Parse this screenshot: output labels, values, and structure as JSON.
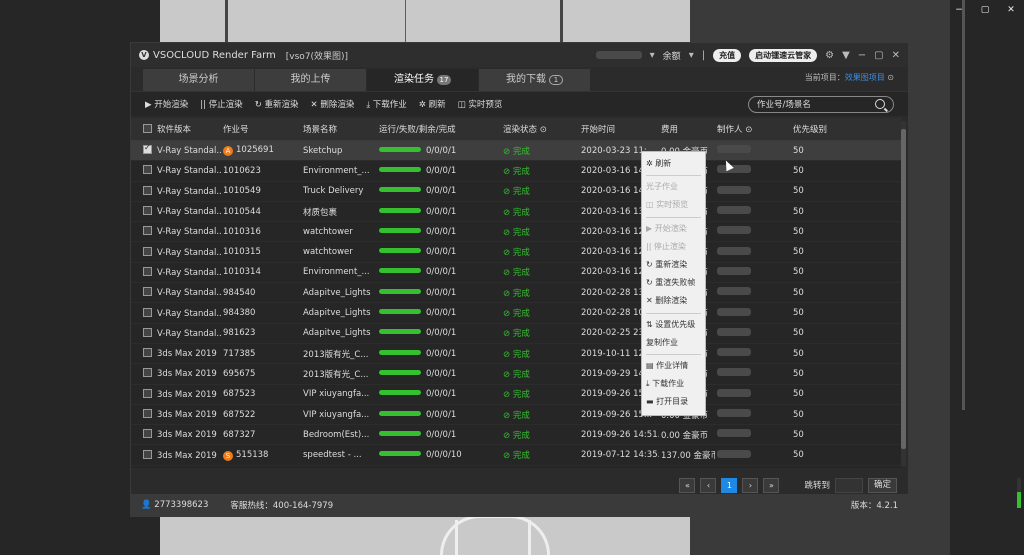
{
  "window_controls": [
    "−",
    "▢",
    "✕"
  ],
  "app": {
    "logo_text": "VSOCLOUD Render Farm",
    "project_label": "[vso7(效果图)]",
    "balance_label": "余额",
    "recharge_label": "充值",
    "start_label": "启动镭速云管家",
    "current_project_label": "当前项目：",
    "current_project_value": "效果图项目"
  },
  "tabs": [
    {
      "label": "场景分析",
      "badge": ""
    },
    {
      "label": "我的上传",
      "badge": ""
    },
    {
      "label": "渲染任务",
      "badge": "17"
    },
    {
      "label": "我的下载",
      "badge": "1"
    }
  ],
  "toolbar": {
    "start": "▶ 开始渲染",
    "stop": "|| 停止渲染",
    "rerender": "↻ 重新渲染",
    "delete": "✕ 删除渲染",
    "download": "⤓ 下载作业",
    "refresh": "✲ 刷新",
    "preview": "◫ 实时预览",
    "search_placeholder": "作业号/场景名"
  },
  "table": {
    "headers": [
      "软件版本",
      "作业号",
      "场景名称",
      "运行/失败/剩余/完成",
      "渲染状态",
      "开始时间",
      "费用",
      "制作人",
      "优先级别"
    ],
    "rows": [
      {
        "software": "V-Ray Standal...",
        "job": "1025691",
        "scene": "Sketchup",
        "progress": "0/0/0/1",
        "status": "⊘ 完成",
        "time": "2020-03-23 11:...",
        "fee": "0.00 金豪币",
        "priority": "50",
        "checked": true,
        "icon": "A"
      },
      {
        "software": "V-Ray Standal...",
        "job": "1010623",
        "scene": "Environment_...",
        "progress": "0/0/0/1",
        "status": "⊘ 完成",
        "time": "2020-03-16 14...",
        "fee": "0.00 金豪币",
        "priority": "50",
        "checked": false,
        "icon": ""
      },
      {
        "software": "V-Ray Standal...",
        "job": "1010549",
        "scene": "Truck Delivery",
        "progress": "0/0/0/1",
        "status": "⊘ 完成",
        "time": "2020-03-16 14...",
        "fee": "0.00 金豪币",
        "priority": "50",
        "checked": false,
        "icon": ""
      },
      {
        "software": "V-Ray Standal...",
        "job": "1010544",
        "scene": "材质包裹",
        "progress": "0/0/0/1",
        "status": "⊘ 完成",
        "time": "2020-03-16 13...",
        "fee": "0.00 金豪币",
        "priority": "50",
        "checked": false,
        "icon": ""
      },
      {
        "software": "V-Ray Standal...",
        "job": "1010316",
        "scene": "watchtower",
        "progress": "0/0/0/1",
        "status": "⊘ 完成",
        "time": "2020-03-16 12...",
        "fee": "0.00 金豪币",
        "priority": "50",
        "checked": false,
        "icon": ""
      },
      {
        "software": "V-Ray Standal...",
        "job": "1010315",
        "scene": "watchtower",
        "progress": "0/0/0/1",
        "status": "⊘ 完成",
        "time": "2020-03-16 12...",
        "fee": "0.00 金豪币",
        "priority": "50",
        "checked": false,
        "icon": ""
      },
      {
        "software": "V-Ray Standal...",
        "job": "1010314",
        "scene": "Environment_...",
        "progress": "0/0/0/1",
        "status": "⊘ 完成",
        "time": "2020-03-16 12...",
        "fee": "0.00 金豪币",
        "priority": "50",
        "checked": false,
        "icon": ""
      },
      {
        "software": "V-Ray Standal...",
        "job": "984540",
        "scene": "Adapitve_Lights",
        "progress": "0/0/0/1",
        "status": "⊘ 完成",
        "time": "2020-02-28 13...",
        "fee": "0.00 金豪币",
        "priority": "50",
        "checked": false,
        "icon": ""
      },
      {
        "software": "V-Ray Standal...",
        "job": "984380",
        "scene": "Adapitve_Lights",
        "progress": "0/0/0/1",
        "status": "⊘ 完成",
        "time": "2020-02-28 10...",
        "fee": "0.00 金豪币",
        "priority": "50",
        "checked": false,
        "icon": ""
      },
      {
        "software": "V-Ray Standal...",
        "job": "981623",
        "scene": "Adapitve_Lights",
        "progress": "0/0/0/1",
        "status": "⊘ 完成",
        "time": "2020-02-25 23...",
        "fee": "0.00 金豪币",
        "priority": "50",
        "checked": false,
        "icon": ""
      },
      {
        "software": "3ds Max 2019",
        "job": "717385",
        "scene": "2013版有光_C...",
        "progress": "0/0/0/1",
        "status": "⊘ 完成",
        "time": "2019-10-11 12...",
        "fee": "0.00 金豪币",
        "priority": "50",
        "checked": false,
        "icon": ""
      },
      {
        "software": "3ds Max 2019",
        "job": "695675",
        "scene": "2013版有光_C...",
        "progress": "0/0/0/1",
        "status": "⊘ 完成",
        "time": "2019-09-29 14...",
        "fee": "0.00 金豪币",
        "priority": "50",
        "checked": false,
        "icon": ""
      },
      {
        "software": "3ds Max 2019",
        "job": "687523",
        "scene": "VIP xiuyangfa...",
        "progress": "0/0/0/1",
        "status": "⊘ 完成",
        "time": "2019-09-26 15...",
        "fee": "0.00 金豪币",
        "priority": "50",
        "checked": false,
        "icon": ""
      },
      {
        "software": "3ds Max 2019",
        "job": "687522",
        "scene": "VIP xiuyangfa...",
        "progress": "0/0/0/1",
        "status": "⊘ 完成",
        "time": "2019-09-26 15...",
        "fee": "0.00 金豪币",
        "priority": "50",
        "checked": false,
        "icon": ""
      },
      {
        "software": "3ds Max 2019",
        "job": "687327",
        "scene": "Bedroom(Est)...",
        "progress": "0/0/0/1",
        "status": "⊘ 完成",
        "time": "2019-09-26 14:51...",
        "fee": "0.00 金豪币",
        "priority": "50",
        "checked": false,
        "icon": ""
      },
      {
        "software": "3ds Max 2019",
        "job": "515138",
        "scene": "speedtest - ...",
        "progress": "0/0/0/10",
        "status": "⊘ 完成",
        "time": "2019-07-12 14:35...",
        "fee": "137.00 金豪币",
        "priority": "50",
        "checked": false,
        "icon": "S"
      }
    ]
  },
  "context_menu": [
    {
      "label": "✲ 刷新",
      "disabled": false
    },
    {
      "sep": true
    },
    {
      "label": "光子作业",
      "disabled": true
    },
    {
      "label": "◫ 实时预览",
      "disabled": true
    },
    {
      "sep": true
    },
    {
      "label": "▶ 开始渲染",
      "disabled": true
    },
    {
      "label": "|| 停止渲染",
      "disabled": true
    },
    {
      "label": "↻ 重新渲染",
      "disabled": false
    },
    {
      "label": "↻ 重渲失败帧",
      "disabled": false
    },
    {
      "label": "✕ 删除渲染",
      "disabled": false
    },
    {
      "sep": true
    },
    {
      "label": "⇅ 设置优先级",
      "disabled": false
    },
    {
      "label": "复制作业",
      "disabled": false
    },
    {
      "sep": true
    },
    {
      "label": "▤ 作业详情",
      "disabled": false
    },
    {
      "label": "⤓ 下载作业",
      "disabled": false
    },
    {
      "label": "▬ 打开目录",
      "disabled": false
    }
  ],
  "pager": {
    "first": "«",
    "prev": "‹",
    "current": "1",
    "next": "›",
    "last": "»",
    "goto_label": "跳转到",
    "ok": "确定"
  },
  "status": {
    "user": "2773398623",
    "hotline": "客服热线：400-164-7979",
    "version": "版本：4.2.1"
  },
  "colors": {
    "accent": "#1e88e5",
    "progress": "#35c12f"
  }
}
